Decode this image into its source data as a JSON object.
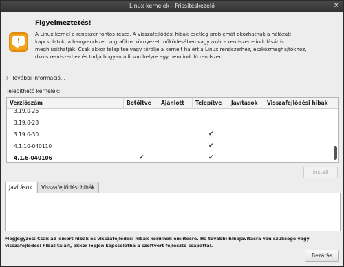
{
  "window": {
    "title": "Linux kernelek - Frissítéskezelő",
    "close_glyph": "✕"
  },
  "warning": {
    "icon": "warning-chat-icon",
    "icon_glyph": "!",
    "title": "Figyelmeztetés!",
    "text": "A Linux kernel a rendszer fontos része. A visszafejlődési hibák esetleg problémát  okozhatnak a hálózati\nkapcsolatok, a hangrendszer, a grafikus környezet működésében  vagy akár a rendszer elindulását is\nmeghiúsíthatják. Csak akkor telepítse vagy törölje a  kernelt ha ért a Linux rendszerhez, eszközmeghajtókhoz,\ndkms rendszerhez és  tudja hogyan állítson helyre egy nem induló rendszert."
  },
  "more_info": {
    "expander": "+",
    "label": "További információ..."
  },
  "kernel_list": {
    "label": "Telepíthető kernelek:",
    "columns": [
      "Verziószám",
      "Betöltve",
      "Ajánlott",
      "Telepítve",
      "Javítások",
      "Visszafejlődési hibák"
    ],
    "check_glyph": "✔",
    "rows": [
      {
        "version": "3.19.0-26",
        "loaded": false,
        "recommended": false,
        "installed": false,
        "bold": false
      },
      {
        "version": "3.19.0-28",
        "loaded": false,
        "recommended": false,
        "installed": false,
        "bold": false
      },
      {
        "version": "3.19.0-30",
        "loaded": false,
        "recommended": false,
        "installed": true,
        "bold": false
      },
      {
        "version": "4.1.10-040110",
        "loaded": false,
        "recommended": false,
        "installed": true,
        "bold": false
      },
      {
        "version": "4.1.6-040106",
        "loaded": true,
        "recommended": false,
        "installed": true,
        "bold": true
      }
    ]
  },
  "install_button": {
    "label": "Install"
  },
  "tabs": [
    {
      "label": "Javítások",
      "active": true
    },
    {
      "label": "Visszafejlődési hibák",
      "active": false
    }
  ],
  "note": {
    "bold": "Megjegyzés:",
    "text": "Csak az ismert hibák és visszafejlődési hibák kerülnek említésre. Ha további hibajavításra van szüksége vagy visszafejlődési hibát talált, akkor lépjen kapcsolatba a szoftvert fejlesztő csapattal."
  },
  "close_button": {
    "label": "Bezárás"
  }
}
